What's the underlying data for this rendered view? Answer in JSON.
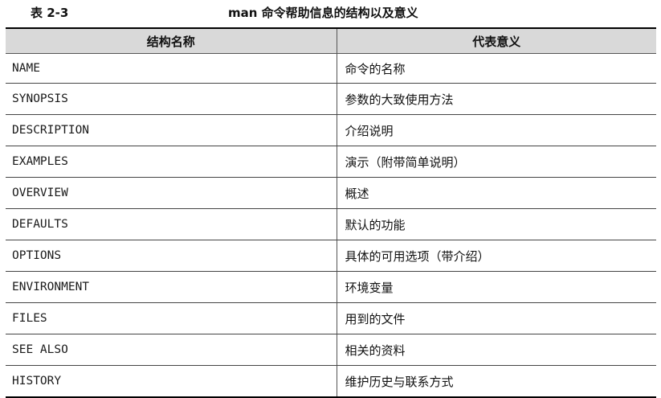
{
  "caption": {
    "number": "表 2-3",
    "title": "man 命令帮助信息的结构以及意义"
  },
  "table": {
    "headers": [
      "结构名称",
      "代表意义"
    ],
    "rows": [
      {
        "name": "NAME",
        "meaning": "命令的名称"
      },
      {
        "name": "SYNOPSIS",
        "meaning": "参数的大致使用方法"
      },
      {
        "name": "DESCRIPTION",
        "meaning": "介绍说明"
      },
      {
        "name": "EXAMPLES",
        "meaning": "演示（附带简单说明）"
      },
      {
        "name": "OVERVIEW",
        "meaning": "概述"
      },
      {
        "name": "DEFAULTS",
        "meaning": "默认的功能"
      },
      {
        "name": "OPTIONS",
        "meaning": "具体的可用选项（带介绍）"
      },
      {
        "name": "ENVIRONMENT",
        "meaning": "环境变量"
      },
      {
        "name": "FILES",
        "meaning": "用到的文件"
      },
      {
        "name": "SEE ALSO",
        "meaning": "相关的资料"
      },
      {
        "name": "HISTORY",
        "meaning": "维护历史与联系方式"
      }
    ]
  },
  "colors": {
    "header_background": "#d9d9d9",
    "rule": "#000000"
  }
}
